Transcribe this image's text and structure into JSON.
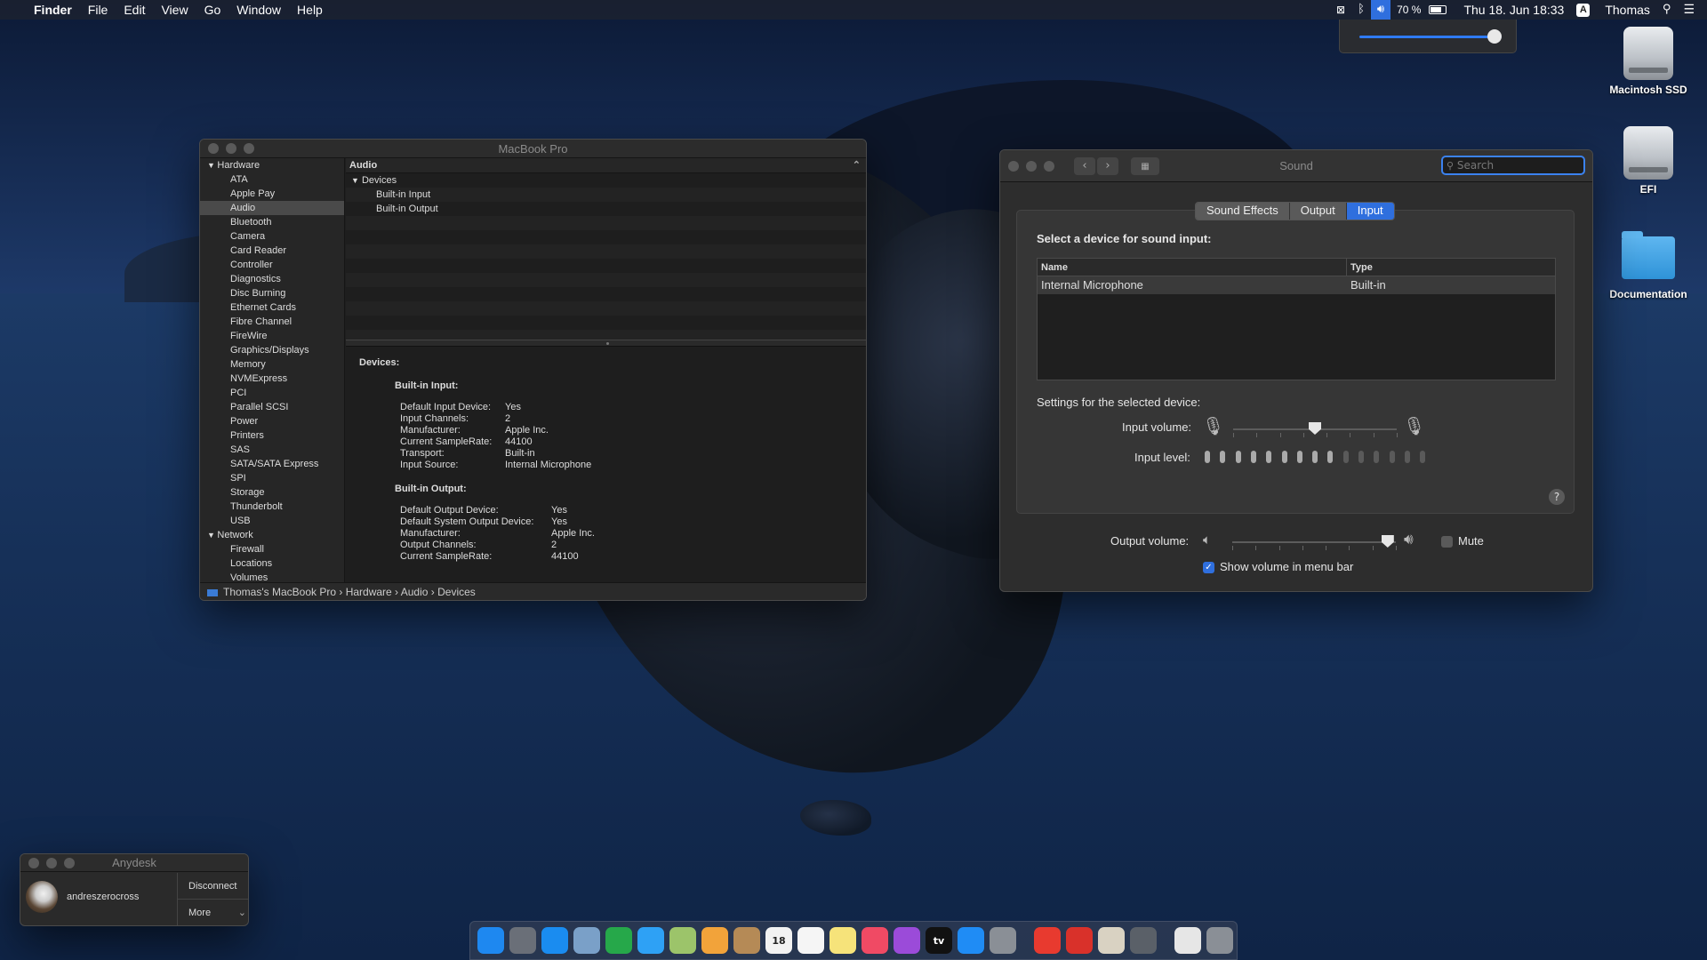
{
  "menubar": {
    "app": "Finder",
    "menus": [
      "File",
      "Edit",
      "View",
      "Go",
      "Window",
      "Help"
    ],
    "battery": "70 %",
    "datetime": "Thu 18. Jun  18:33",
    "input_source": "A",
    "user": "Thomas"
  },
  "volume_popover": {
    "level": 0.95
  },
  "desktop": {
    "icons": [
      {
        "label": "Macintosh SSD",
        "icon": "hard-drive-icon"
      },
      {
        "label": "EFI",
        "icon": "hard-drive-icon"
      },
      {
        "label": "Documentation",
        "icon": "folder-icon"
      }
    ]
  },
  "sysinfo": {
    "title": "MacBook Pro",
    "sidebar": {
      "groups": [
        {
          "label": "Hardware",
          "items": [
            "ATA",
            "Apple Pay",
            "Audio",
            "Bluetooth",
            "Camera",
            "Card Reader",
            "Controller",
            "Diagnostics",
            "Disc Burning",
            "Ethernet Cards",
            "Fibre Channel",
            "FireWire",
            "Graphics/Displays",
            "Memory",
            "NVMExpress",
            "PCI",
            "Parallel SCSI",
            "Power",
            "Printers",
            "SAS",
            "SATA/SATA Express",
            "SPI",
            "Storage",
            "Thunderbolt",
            "USB"
          ]
        },
        {
          "label": "Network",
          "items": [
            "Firewall",
            "Locations",
            "Volumes"
          ]
        }
      ],
      "selected": "Audio"
    },
    "list": {
      "header": "Audio",
      "group": "Devices",
      "rows": [
        "Built-in Input",
        "Built-in Output"
      ]
    },
    "detail": {
      "heading": "Devices:",
      "sections": [
        {
          "title": "Built-in Input:",
          "rows": [
            {
              "k": "Default Input Device:",
              "v": "Yes"
            },
            {
              "k": "Input Channels:",
              "v": "2"
            },
            {
              "k": "Manufacturer:",
              "v": "Apple Inc."
            },
            {
              "k": "Current SampleRate:",
              "v": "44100"
            },
            {
              "k": "Transport:",
              "v": "Built-in"
            },
            {
              "k": "Input Source:",
              "v": "Internal Microphone"
            }
          ]
        },
        {
          "title": "Built-in Output:",
          "rows": [
            {
              "k": "Default Output Device:",
              "v": "Yes"
            },
            {
              "k": "Default System Output Device:",
              "v": "Yes"
            },
            {
              "k": "Manufacturer:",
              "v": "Apple Inc."
            },
            {
              "k": "Output Channels:",
              "v": "2"
            },
            {
              "k": "Current SampleRate:",
              "v": "44100"
            }
          ]
        }
      ]
    },
    "breadcrumb": [
      "Thomas's MacBook Pro",
      "Hardware",
      "Audio",
      "Devices"
    ]
  },
  "sound": {
    "title": "Sound",
    "search_placeholder": "Search",
    "tabs": [
      "Sound Effects",
      "Output",
      "Input"
    ],
    "active_tab": "Input",
    "select_label": "Select a device for sound input:",
    "table": {
      "columns": [
        "Name",
        "Type"
      ],
      "rows": [
        {
          "name": "Internal Microphone",
          "type": "Built-in"
        }
      ]
    },
    "settings_label": "Settings for the selected device:",
    "input_volume_label": "Input volume:",
    "input_volume": 0.5,
    "input_level_label": "Input level:",
    "input_level_segments": 15,
    "input_level_active": 9,
    "help": "?",
    "output_volume_label": "Output volume:",
    "output_volume": 0.95,
    "mute_label": "Mute",
    "mute": false,
    "show_volume_label": "Show volume in menu bar",
    "show_volume": true
  },
  "anydesk": {
    "title": "Anydesk",
    "user": "andreszerocross",
    "disconnect": "Disconnect",
    "more": "More"
  },
  "dock": {
    "apps": [
      {
        "name": "finder-icon",
        "color": "#1e88f0"
      },
      {
        "name": "launchpad-icon",
        "color": "#6a6f78"
      },
      {
        "name": "safari-icon",
        "color": "#1a8cf0"
      },
      {
        "name": "preview-icon",
        "color": "#7aa0c8"
      },
      {
        "name": "facetime-icon",
        "color": "#26a84a"
      },
      {
        "name": "messages-icon",
        "color": "#2ea1f5"
      },
      {
        "name": "maps-icon",
        "color": "#9cc46a"
      },
      {
        "name": "photos-icon",
        "color": "#f2a33a"
      },
      {
        "name": "contacts-icon",
        "color": "#b58a56"
      },
      {
        "name": "calendar-icon",
        "color": "#f2f2f2",
        "label": "18"
      },
      {
        "name": "reminders-icon",
        "color": "#f5f5f5"
      },
      {
        "name": "notes-icon",
        "color": "#f6e37a"
      },
      {
        "name": "music-icon",
        "color": "#f04a64"
      },
      {
        "name": "podcasts-icon",
        "color": "#9b4bd9"
      },
      {
        "name": "appletv-icon",
        "color": "#111111",
        "label": "tv"
      },
      {
        "name": "appstore-icon",
        "color": "#1f8cf5"
      },
      {
        "name": "system-preferences-icon",
        "color": "#8a8f96"
      }
    ],
    "apps2": [
      {
        "name": "anydesk-icon",
        "color": "#e83a2f"
      },
      {
        "name": "anydesk-alt-icon",
        "color": "#d9312a"
      },
      {
        "name": "script-editor-icon",
        "color": "#d9d2c2"
      },
      {
        "name": "automator-icon",
        "color": "#5a6068"
      }
    ],
    "trash": [
      {
        "name": "document-icon",
        "color": "#e6e6e6"
      },
      {
        "name": "trash-icon",
        "color": "#8a8f96"
      }
    ]
  }
}
